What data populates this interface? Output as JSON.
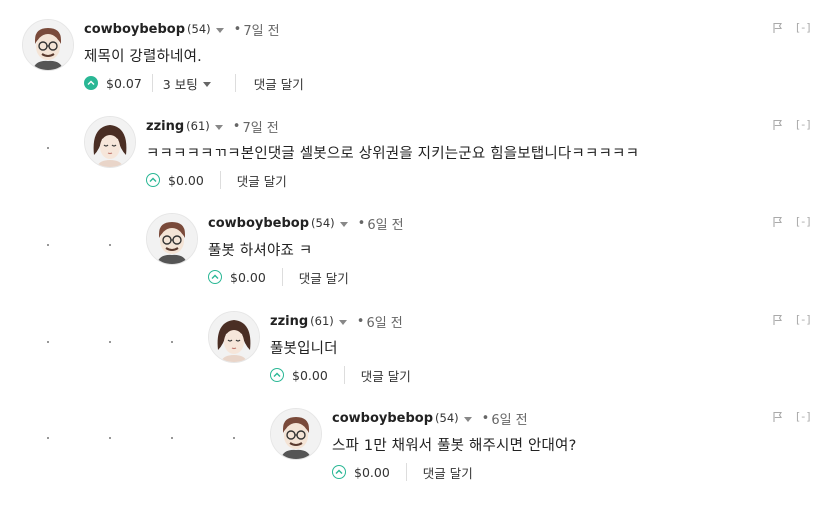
{
  "comments": [
    {
      "author": "cowboybebop",
      "rep": "(54)",
      "time": "7일 전",
      "body": "제목이 강렬하네여.",
      "payout": "$0.07",
      "votes": "3 보팅",
      "reply": "댓글 달기",
      "voted": true,
      "avatar": "male"
    },
    {
      "author": "zzing",
      "rep": "(61)",
      "time": "7일 전",
      "body": "ㅋㅋㅋㅋㅋㄲㅋ본인댓글 셀봇으로 상위권을 지키는군요 힘을보탭니다ㅋㅋㅋㅋㅋ",
      "payout": "$0.00",
      "reply": "댓글 달기",
      "voted": false,
      "avatar": "female"
    },
    {
      "author": "cowboybebop",
      "rep": "(54)",
      "time": "6일 전",
      "body": "풀봇 하셔야죠 ㅋ",
      "payout": "$0.00",
      "reply": "댓글 달기",
      "voted": false,
      "avatar": "male"
    },
    {
      "author": "zzing",
      "rep": "(61)",
      "time": "6일 전",
      "body": "풀봇입니더",
      "payout": "$0.00",
      "reply": "댓글 달기",
      "voted": false,
      "avatar": "female"
    },
    {
      "author": "cowboybebop",
      "rep": "(54)",
      "time": "6일 전",
      "body": "스파 1만 채워서 풀봇 해주시면 안대여?",
      "payout": "$0.00",
      "reply": "댓글 달기",
      "voted": false,
      "avatar": "male"
    }
  ],
  "ui": {
    "dot": "•",
    "collapse": "[-]"
  },
  "icons": {
    "flag": "flag-icon",
    "upvote": "upvote-chevron-icon",
    "caret": "caret-down-icon"
  },
  "colors": {
    "accent": "#2ab795"
  }
}
